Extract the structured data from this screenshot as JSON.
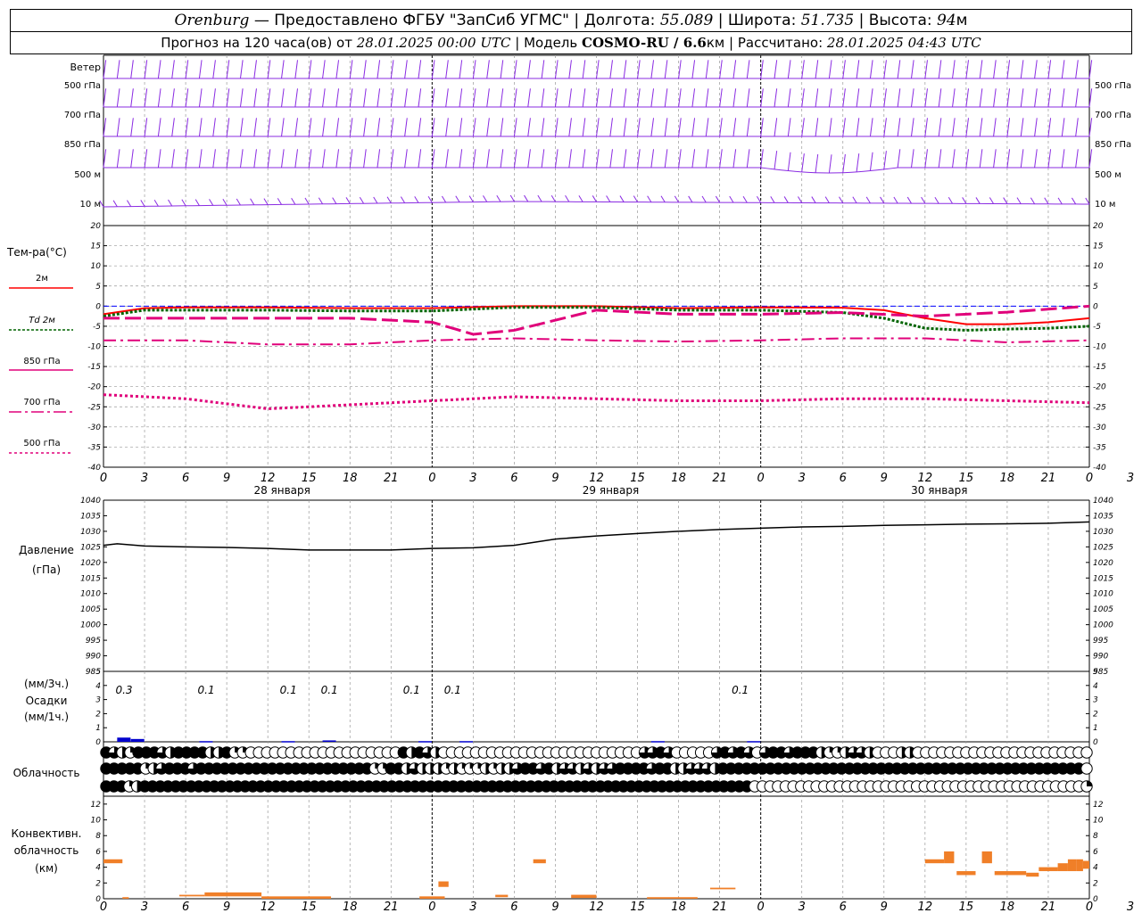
{
  "header": {
    "city": "Orenburg",
    "provider": "— Предоставлено ФГБУ \"ЗапСиб УГМС\" | Долгота: ",
    "lon": "55.089",
    "lat_label": " | Широта: ",
    "lat": "51.735",
    "alt_label": " | Высота: ",
    "alt": "94",
    "alt_unit": "м",
    "forecast_prefix": "Прогноз на 120 часа(ов) от ",
    "start": "28.01.2025 00:00 UTC",
    "model_label": " | Модель ",
    "model": "COSMO-RU / 6.6",
    "model_unit": "км",
    "calc_label": " | Рассчитано: ",
    "calc": "28.01.2025 04:43 UTC"
  },
  "wind_panel": {
    "title": "Ветер",
    "levels": [
      "500 гПа",
      "700 гПа",
      "850 гПа",
      "500 м",
      "10  м"
    ]
  },
  "temp_panel": {
    "title": "Тем-ра(°C)",
    "legend": [
      "2м",
      "Td  2м",
      "850 гПа",
      "700 гПа",
      "500 гПа"
    ]
  },
  "pressure_panel": {
    "title": "Давление",
    "unit": "(гПа)"
  },
  "precip_panel": {
    "label_top": "(мм/3ч.)",
    "title": "Осадки",
    "label_bottom": "(мм/1ч.)"
  },
  "cloud_panel": {
    "title": "Облачность"
  },
  "conv_panel": {
    "title_1": "Конвективн.",
    "title_2": "облачность",
    "unit": "(км)"
  },
  "colors": {
    "wind": "#8a2be2",
    "t2m": "#ff0000",
    "td2m": "#006400",
    "t850": "#e0007a",
    "t700": "#e0007a",
    "t500": "#e0007a",
    "pressure": "#000000",
    "precip": "#0000cd",
    "conv": "#f07f28",
    "zero_line": "#0000ff"
  },
  "chart_data": [
    {
      "type": "line",
      "id": "temperature",
      "ylabel": "Тем-ра(°C)",
      "ylim": [
        -40,
        20
      ],
      "yticks": [
        20,
        15,
        10,
        5,
        0,
        -5,
        -10,
        -15,
        -20,
        -25,
        -30,
        -35,
        -40
      ],
      "xlim": [
        0,
        72
      ],
      "xticks": [
        "0",
        "3",
        "6",
        "9",
        "12",
        "15",
        "18",
        "21",
        "0",
        "3",
        "6",
        "9",
        "12",
        "15",
        "18",
        "21",
        "0",
        "3",
        "6",
        "9",
        "12",
        "15",
        "18",
        "21",
        "0",
        "3",
        "6"
      ],
      "day_labels": [
        "28 января",
        "29 января",
        "30 января"
      ],
      "grid": true,
      "series": [
        {
          "name": "2м",
          "x": [
            0,
            3,
            6,
            12,
            18,
            24,
            30,
            36,
            42,
            48,
            54,
            57,
            60,
            63,
            66,
            69,
            72
          ],
          "values": [
            -2,
            -0.5,
            -0.3,
            -0.3,
            -0.5,
            -0.5,
            0,
            0,
            -0.5,
            -0.3,
            -0.4,
            -1,
            -3,
            -4.5,
            -4.5,
            -4,
            -3
          ]
        },
        {
          "name": "Td  2м",
          "x": [
            0,
            3,
            6,
            12,
            18,
            24,
            30,
            36,
            42,
            48,
            54,
            57,
            60,
            63,
            66,
            69,
            72
          ],
          "values": [
            -2.5,
            -1,
            -1,
            -1,
            -1.2,
            -1.2,
            -0.3,
            -0.3,
            -1,
            -1,
            -1.6,
            -3,
            -5.5,
            -6,
            -5.7,
            -5.5,
            -5
          ]
        },
        {
          "name": "850 гПа",
          "x": [
            0,
            3,
            6,
            12,
            18,
            24,
            27,
            30,
            36,
            42,
            48,
            54,
            60,
            66,
            72
          ],
          "values": [
            -3,
            -3,
            -3,
            -3,
            -3,
            -4,
            -7,
            -6,
            -1,
            -2,
            -2,
            -1.6,
            -2.5,
            -1.5,
            0
          ]
        },
        {
          "name": "700 гПа",
          "x": [
            0,
            6,
            12,
            18,
            24,
            30,
            36,
            42,
            48,
            54,
            60,
            66,
            72
          ],
          "values": [
            -8.5,
            -8.5,
            -9.5,
            -9.5,
            -8.5,
            -8,
            -8.5,
            -8.8,
            -8.5,
            -8,
            -8,
            -9,
            -8.5
          ]
        },
        {
          "name": "500 гПа",
          "x": [
            0,
            6,
            12,
            18,
            24,
            30,
            36,
            42,
            48,
            54,
            60,
            66,
            72
          ],
          "values": [
            -22,
            -23,
            -25.5,
            -24.5,
            -23.5,
            -22.5,
            -23,
            -23.5,
            -23.5,
            -23,
            -23,
            -23.5,
            -24
          ]
        }
      ]
    },
    {
      "type": "line",
      "id": "pressure",
      "ylabel": "Давление (гПа)",
      "ylim": [
        985,
        1040
      ],
      "yticks": [
        1040,
        1035,
        1030,
        1025,
        1020,
        1015,
        1010,
        1005,
        1000,
        995,
        990,
        985
      ],
      "series": [
        {
          "name": "Давление",
          "x": [
            0,
            1,
            3,
            6,
            9,
            12,
            15,
            18,
            21,
            24,
            27,
            30,
            33,
            36,
            39,
            42,
            45,
            48,
            51,
            54,
            57,
            60,
            63,
            66,
            69,
            72
          ],
          "values": [
            1025.5,
            1026,
            1025.3,
            1025,
            1024.8,
            1024.5,
            1024,
            1024,
            1024,
            1024.5,
            1024.7,
            1025.5,
            1027.5,
            1028.5,
            1029.3,
            1030,
            1030.6,
            1031,
            1031.4,
            1031.6,
            1031.9,
            1032.1,
            1032.3,
            1032.4,
            1032.6,
            1033
          ]
        }
      ]
    },
    {
      "type": "bar",
      "id": "precipitation",
      "ylabel": "Осадки",
      "ylim": [
        0,
        5
      ],
      "yticks": [
        5,
        4,
        3,
        2,
        1,
        0
      ],
      "annotations": [
        {
          "x": 1.5,
          "text": "0.3"
        },
        {
          "x": 7.5,
          "text": "0.1"
        },
        {
          "x": 13.5,
          "text": "0.1"
        },
        {
          "x": 16.5,
          "text": "0.1"
        },
        {
          "x": 22.5,
          "text": "0.1"
        },
        {
          "x": 25.5,
          "text": "0.1"
        },
        {
          "x": 46.5,
          "text": "0.1"
        }
      ],
      "bars": [
        {
          "x": 1,
          "value": 0.3
        },
        {
          "x": 2,
          "value": 0.2
        },
        {
          "x": 7,
          "value": 0.05
        },
        {
          "x": 13,
          "value": 0.05
        },
        {
          "x": 16,
          "value": 0.1
        },
        {
          "x": 23,
          "value": 0.05
        },
        {
          "x": 26,
          "value": 0.05
        },
        {
          "x": 40,
          "value": 0.05
        },
        {
          "x": 47,
          "value": 0.05
        }
      ]
    },
    {
      "type": "table",
      "id": "cloudiness",
      "ylabel": "Облачность",
      "rows": [
        [
          1,
          0.75,
          0.5,
          0.25,
          1,
          1,
          1,
          0.75,
          0.5,
          1,
          1,
          1,
          1,
          0.5,
          0.5,
          1,
          0.25,
          0.25,
          0,
          0,
          0,
          0,
          0,
          0,
          0,
          0,
          0,
          0,
          0,
          0,
          0,
          0,
          0,
          0,
          0,
          0,
          0,
          1,
          0.5,
          1,
          0.75,
          0.5,
          0,
          0,
          0,
          0,
          0,
          0,
          0,
          0,
          0,
          0,
          0,
          0,
          0,
          0,
          0,
          0,
          0,
          0,
          0,
          0,
          0,
          0,
          0,
          0,
          0,
          0.75,
          0.75,
          1,
          0.75,
          0,
          0,
          0,
          0,
          0,
          0.75,
          1,
          0.75,
          1,
          0.75,
          0,
          0.75,
          1,
          1,
          0.75,
          1,
          1,
          1,
          0.5,
          0.25,
          0.25,
          0.5,
          0.75,
          0.75,
          0.5,
          0,
          0,
          0,
          0.5,
          0.5,
          0,
          0,
          0,
          0,
          0,
          0,
          0,
          0,
          0,
          0,
          0,
          0,
          0,
          0,
          0,
          0,
          0,
          0,
          0,
          0,
          0,
          0
        ],
        [
          1,
          1,
          1,
          1,
          1,
          0.25,
          0.5,
          0.75,
          1,
          1,
          1,
          0.75,
          1,
          1,
          1,
          1,
          1,
          1,
          1,
          1,
          1,
          1,
          1,
          1,
          1,
          1,
          1,
          1,
          1,
          1,
          1,
          1,
          1,
          1,
          0.25,
          0.25,
          1,
          1,
          0.5,
          0.75,
          0.5,
          0.5,
          0.5,
          0.25,
          0.5,
          0.25,
          0.25,
          0.25,
          0.5,
          0.25,
          0.5,
          0.5,
          0.75,
          1,
          1,
          0.75,
          1,
          0.5,
          0.75,
          0.75,
          0.5,
          0.75,
          0.5,
          0.75,
          0.75,
          1,
          1,
          1,
          1,
          0.75,
          1,
          1,
          0.5,
          0.5,
          0.75,
          0.75,
          0.75,
          0.5,
          1,
          1,
          1,
          1,
          1,
          1,
          1,
          1,
          1,
          1,
          1,
          1,
          1,
          1,
          1,
          1,
          1,
          1,
          1,
          1,
          1,
          1,
          1,
          1,
          1,
          1,
          1,
          1,
          1,
          1,
          1,
          1,
          1,
          1,
          1,
          1,
          1,
          1,
          1,
          1,
          1,
          1,
          1,
          1,
          1,
          1,
          0
        ],
        [
          1,
          1,
          1,
          0.25,
          0.5,
          1,
          1,
          1,
          1,
          1,
          1,
          1,
          1,
          1,
          1,
          1,
          1,
          1,
          1,
          1,
          1,
          1,
          1,
          1,
          1,
          1,
          1,
          1,
          1,
          1,
          1,
          1,
          1,
          1,
          1,
          1,
          1,
          1,
          1,
          1,
          1,
          1,
          1,
          1,
          1,
          1,
          1,
          1,
          1,
          1,
          1,
          1,
          1,
          1,
          1,
          1,
          1,
          1,
          1,
          1,
          1,
          1,
          1,
          1,
          1,
          1,
          1,
          1,
          1,
          1,
          1,
          1,
          1,
          1,
          1,
          1,
          1,
          1,
          1,
          1,
          1,
          1,
          1,
          1,
          0,
          0,
          0,
          0,
          0,
          0,
          0,
          0,
          0,
          0,
          0,
          0,
          0,
          0,
          0,
          0,
          0,
          0,
          0,
          0,
          0,
          0,
          0,
          0,
          0,
          0,
          0,
          0,
          0,
          0,
          0,
          0,
          0,
          0,
          0,
          0,
          0,
          0,
          0,
          0,
          0,
          0,
          0,
          0.25
        ]
      ]
    },
    {
      "type": "bar",
      "id": "convective",
      "ylabel": "Конвективн. облачность (км)",
      "ylim": [
        0,
        13
      ],
      "yticks": [
        12,
        10,
        8,
        6,
        4,
        2,
        0
      ],
      "segments": [
        {
          "x0": 0,
          "x1": 1.5,
          "bottom": 4.5,
          "top": 5
        },
        {
          "x0": 1.5,
          "x1": 2,
          "bottom": 0,
          "top": 0.2
        },
        {
          "x0": 6,
          "x1": 8,
          "bottom": 0.3,
          "top": 0.5
        },
        {
          "x0": 8,
          "x1": 12.5,
          "bottom": 0.3,
          "top": 0.8
        },
        {
          "x0": 12.5,
          "x1": 18,
          "bottom": 0,
          "top": 0.3
        },
        {
          "x0": 25,
          "x1": 27,
          "bottom": 0,
          "top": 0.3
        },
        {
          "x0": 26.5,
          "x1": 27.3,
          "bottom": 1.5,
          "top": 2.2
        },
        {
          "x0": 31,
          "x1": 32,
          "bottom": 0.2,
          "top": 0.5
        },
        {
          "x0": 34,
          "x1": 35,
          "bottom": 4.5,
          "top": 5
        },
        {
          "x0": 37,
          "x1": 39,
          "bottom": 0.1,
          "top": 0.5
        },
        {
          "x0": 43,
          "x1": 47,
          "bottom": 0,
          "top": 0.2
        },
        {
          "x0": 48,
          "x1": 50,
          "bottom": 1.2,
          "top": 1.4
        },
        {
          "x0": 65,
          "x1": 66.5,
          "bottom": 4.5,
          "top": 5
        },
        {
          "x0": 66.5,
          "x1": 67.3,
          "bottom": 4.5,
          "top": 6
        },
        {
          "x0": 67.5,
          "x1": 69,
          "bottom": 3,
          "top": 3.5
        },
        {
          "x0": 69.5,
          "x1": 70.3,
          "bottom": 4.5,
          "top": 6
        },
        {
          "x0": 70.5,
          "x1": 72,
          "bottom": 3,
          "top": 3.5
        },
        {
          "x0": 72,
          "x1": 73,
          "bottom": 3,
          "top": 3.5
        },
        {
          "x0": 73,
          "x1": 74,
          "bottom": 2.8,
          "top": 3.3
        },
        {
          "x0": 74,
          "x1": 75.5,
          "bottom": 3.5,
          "top": 4
        },
        {
          "x0": 75.5,
          "x1": 76.3,
          "bottom": 3.5,
          "top": 4.5
        },
        {
          "x0": 76.3,
          "x1": 77,
          "bottom": 3.5,
          "top": 5
        },
        {
          "x0": 77,
          "x1": 77.5,
          "bottom": 3.5,
          "top": 5
        },
        {
          "x0": 77.5,
          "x1": 78,
          "bottom": 3.8,
          "top": 4.8
        }
      ]
    }
  ]
}
